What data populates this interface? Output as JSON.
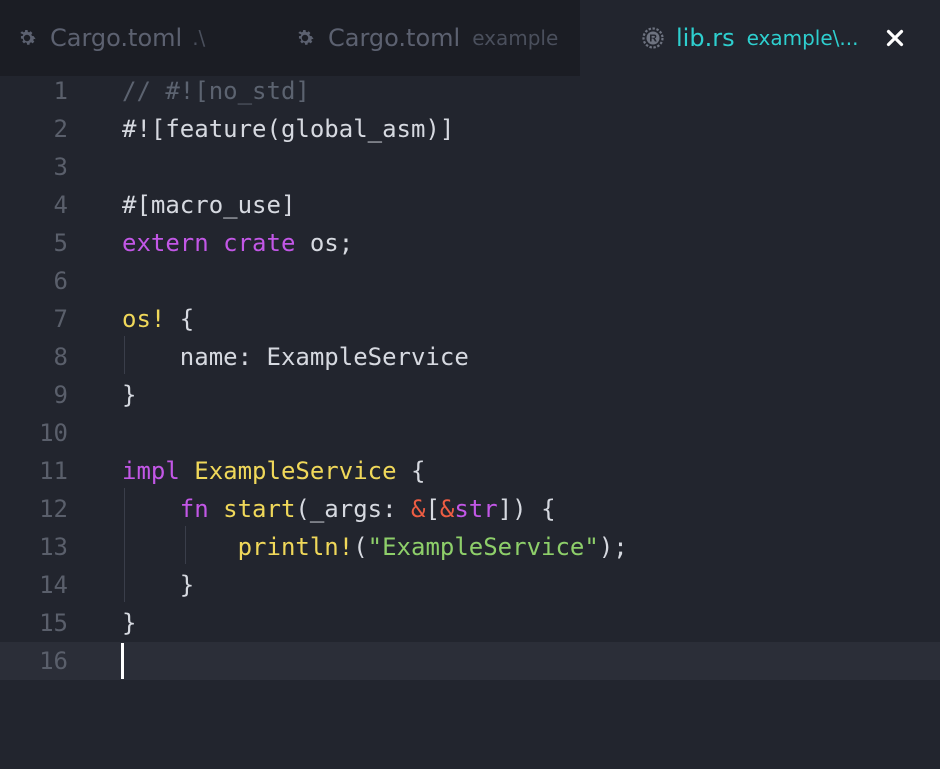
{
  "tabs": [
    {
      "name": "Cargo.toml",
      "hint": ".\\",
      "icon": "gear-icon",
      "active": false
    },
    {
      "name": "Cargo.toml",
      "hint": "example",
      "icon": "gear-icon",
      "active": false
    },
    {
      "name": "lib.rs",
      "hint": "example\\...",
      "icon": "rust-icon",
      "active": true
    }
  ],
  "close_glyph": "✕",
  "colors": {
    "background": "#22252e",
    "tabbar": "#1b1d24",
    "active_tab_text": "#2ecfcf",
    "keyword": "#c257e6",
    "macro": "#f0d85a",
    "string": "#8ecf6a",
    "ampersand": "#ee5d43",
    "comment": "#5c6370"
  },
  "editor": {
    "current_line": 16,
    "lines": [
      {
        "num": "1",
        "tokens": [
          {
            "t": "// #![no_std]",
            "c": "comment"
          }
        ]
      },
      {
        "num": "2",
        "tokens": [
          {
            "t": "#![feature(global_asm)]",
            "c": "plain"
          }
        ]
      },
      {
        "num": "3",
        "tokens": []
      },
      {
        "num": "4",
        "tokens": [
          {
            "t": "#[macro_use]",
            "c": "plain"
          }
        ]
      },
      {
        "num": "5",
        "tokens": [
          {
            "t": "extern",
            "c": "kw"
          },
          {
            "t": " ",
            "c": "plain"
          },
          {
            "t": "crate",
            "c": "kw"
          },
          {
            "t": " os;",
            "c": "plain"
          }
        ]
      },
      {
        "num": "6",
        "tokens": []
      },
      {
        "num": "7",
        "tokens": [
          {
            "t": "os!",
            "c": "macro"
          },
          {
            "t": " {",
            "c": "plain"
          }
        ]
      },
      {
        "num": "8",
        "tokens": [
          {
            "t": "    name: ExampleService",
            "c": "plain"
          }
        ]
      },
      {
        "num": "9",
        "tokens": [
          {
            "t": "}",
            "c": "plain"
          }
        ]
      },
      {
        "num": "10",
        "tokens": []
      },
      {
        "num": "11",
        "tokens": [
          {
            "t": "impl",
            "c": "kw"
          },
          {
            "t": " ",
            "c": "plain"
          },
          {
            "t": "ExampleService",
            "c": "type"
          },
          {
            "t": " {",
            "c": "plain"
          }
        ]
      },
      {
        "num": "12",
        "tokens": [
          {
            "t": "    ",
            "c": "plain"
          },
          {
            "t": "fn",
            "c": "kw"
          },
          {
            "t": " ",
            "c": "plain"
          },
          {
            "t": "start",
            "c": "fn"
          },
          {
            "t": "(_args: ",
            "c": "plain"
          },
          {
            "t": "&",
            "c": "amp"
          },
          {
            "t": "[",
            "c": "plain"
          },
          {
            "t": "&",
            "c": "amp"
          },
          {
            "t": "str",
            "c": "kw"
          },
          {
            "t": "]) {",
            "c": "plain"
          }
        ]
      },
      {
        "num": "13",
        "tokens": [
          {
            "t": "        ",
            "c": "plain"
          },
          {
            "t": "println!",
            "c": "macro"
          },
          {
            "t": "(",
            "c": "plain"
          },
          {
            "t": "\"ExampleService\"",
            "c": "str"
          },
          {
            "t": ");",
            "c": "plain"
          }
        ]
      },
      {
        "num": "14",
        "tokens": [
          {
            "t": "    }",
            "c": "plain"
          }
        ]
      },
      {
        "num": "15",
        "tokens": [
          {
            "t": "}",
            "c": "plain"
          }
        ]
      },
      {
        "num": "16",
        "tokens": []
      }
    ]
  }
}
